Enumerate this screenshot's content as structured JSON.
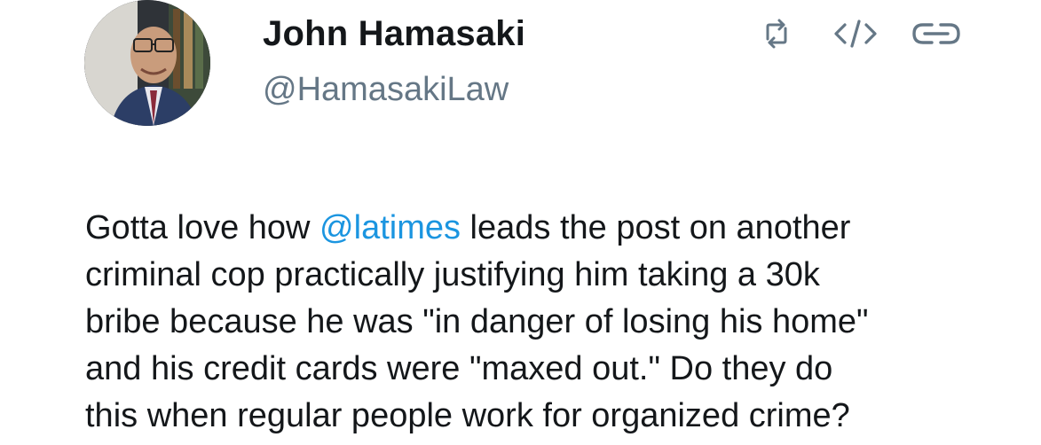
{
  "author": {
    "display_name": "John Hamasaki",
    "handle": "@HamasakiLaw"
  },
  "actions": {
    "retweet_icon": "retweet-icon",
    "embed_icon": "code-embed-icon",
    "link_icon": "link-icon"
  },
  "tweet": {
    "line1_before": "Gotta love how ",
    "mention": "@latimes",
    "line1_after": " leads the post on another",
    "line2": "criminal cop practically justifying him taking a 30k",
    "line3": "bribe because he was \"in danger of losing his home\"",
    "line4": "and his credit cards were \"maxed out.\" Do they do",
    "line5": "this when regular people work for organized crime?"
  },
  "colors": {
    "mention": "#1b95e0",
    "handle": "#657786",
    "text": "#14171a",
    "icon": "#657786"
  }
}
